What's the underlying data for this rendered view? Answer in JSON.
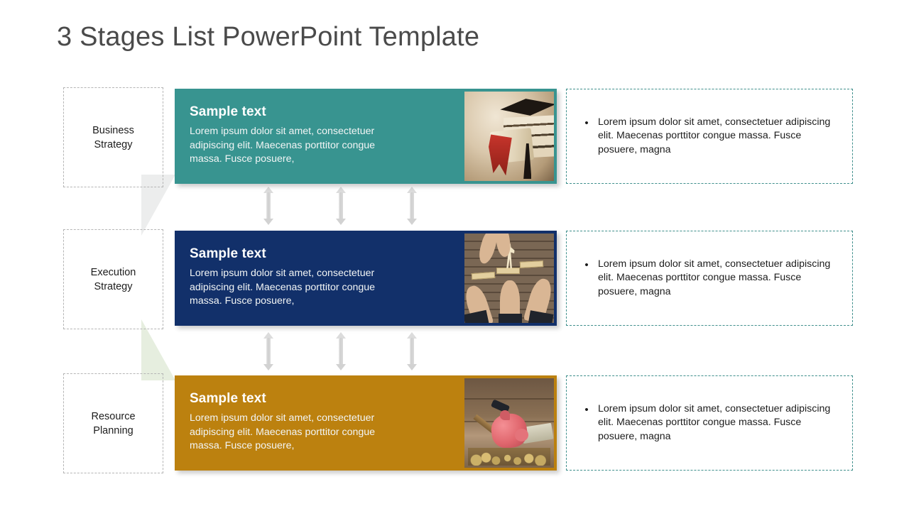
{
  "slide": {
    "title": "3 Stages List PowerPoint Template",
    "background_color": "#ffffff"
  },
  "colors": {
    "teal": "#389490",
    "navy": "#12306A",
    "gold": "#BC810F",
    "chevron_gray": "#ECEDED",
    "chevron_green": "#E6EEDF",
    "dashed_gray": "#B5B5B5",
    "dashed_teal": "#3F8F8C",
    "arrow_gray": "#D6D6D6",
    "title_text": "#4A4A4A"
  },
  "stages": [
    {
      "label": "Business\nStrategy",
      "card": {
        "heading": "Sample text",
        "body": "Lorem ipsum dolor sit amet, consectetuer adipiscing elit. Maecenas porttitor congue massa. Fusce posuere,",
        "color": "#389490",
        "image_name": "graduation-cap-diploma-photo"
      },
      "bullet": {
        "marker": "•",
        "text": "Lorem ipsum dolor sit amet, consectetuer adipiscing elit. Maecenas porttitor congue massa. Fusce posuere, magna"
      }
    },
    {
      "label": "Execution\nStrategy",
      "card": {
        "heading": "Sample text",
        "body": "Lorem ipsum dolor sit amet, consectetuer adipiscing elit. Maecenas porttitor congue massa. Fusce posuere,",
        "color": "#12306A",
        "image_name": "hands-pointing-wooden-blocks-photo"
      },
      "bullet": {
        "marker": "•",
        "text": "Lorem ipsum dolor sit amet, consectetuer adipiscing elit. Maecenas porttitor congue massa. Fusce posuere, magna"
      }
    },
    {
      "label": "Resource\nPlanning",
      "card": {
        "heading": "Sample text",
        "body": "Lorem ipsum dolor sit amet, consectetuer adipiscing elit. Maecenas porttitor congue massa. Fusce posuere,",
        "color": "#BC810F",
        "image_name": "piggy-bank-hammer-coins-photo"
      },
      "bullet": {
        "marker": "•",
        "text": "Lorem ipsum dolor sit amet, consectetuer adipiscing elit. Maecenas porttitor congue massa. Fusce posuere, magna"
      }
    }
  ],
  "connectors": {
    "icon_name": "double-headed-vertical-arrow",
    "count_per_gap": 3,
    "gaps": 2
  }
}
